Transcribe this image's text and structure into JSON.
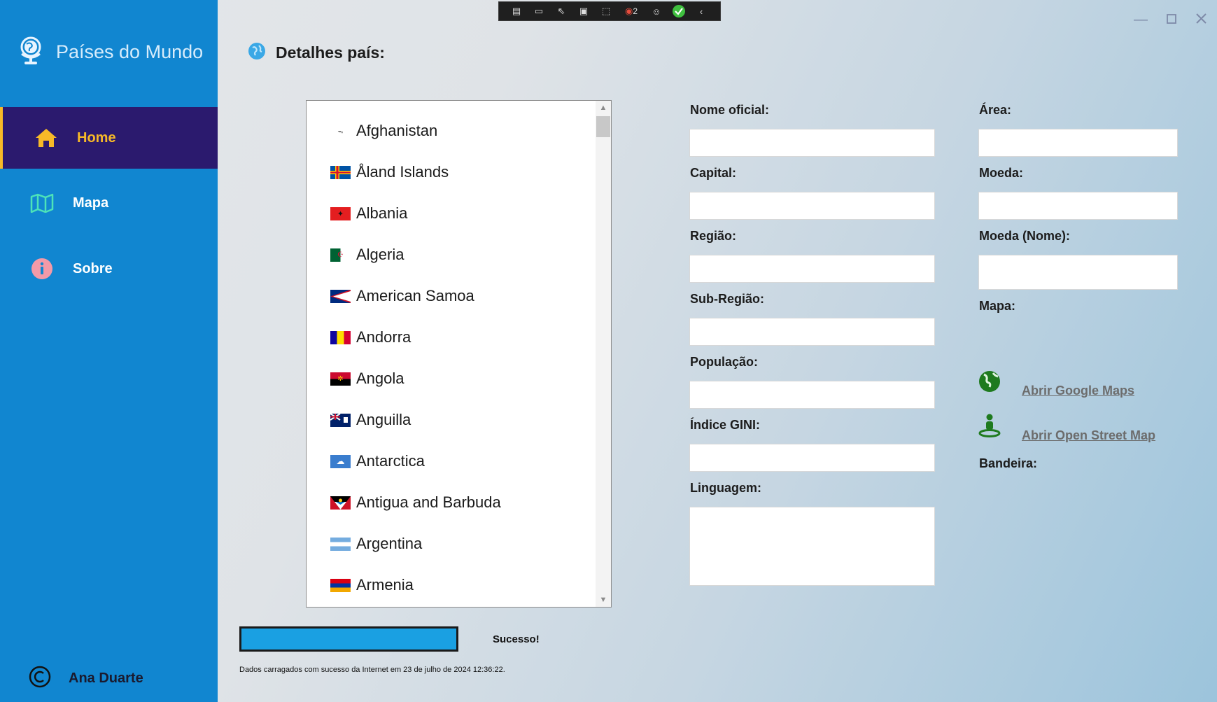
{
  "app": {
    "title": "Países do Mundo",
    "ghost_text": ""
  },
  "sidebar": {
    "items": [
      {
        "label": "Home",
        "icon": "home-icon",
        "active": true
      },
      {
        "label": "Mapa",
        "icon": "map-icon",
        "active": false
      },
      {
        "label": "Sobre",
        "icon": "info-icon",
        "active": false
      }
    ],
    "author": "Ana Duarte"
  },
  "toolbar": {
    "live_count": "2"
  },
  "main": {
    "title": "Detalhes país:",
    "countries": [
      {
        "name": "Afghanistan"
      },
      {
        "name": "Åland Islands"
      },
      {
        "name": "Albania"
      },
      {
        "name": "Algeria"
      },
      {
        "name": "American Samoa"
      },
      {
        "name": "Andorra"
      },
      {
        "name": "Angola"
      },
      {
        "name": "Anguilla"
      },
      {
        "name": "Antarctica"
      },
      {
        "name": "Antigua and Barbuda"
      },
      {
        "name": "Argentina"
      },
      {
        "name": "Armenia"
      }
    ],
    "fields": {
      "nome_oficial": {
        "label": "Nome oficial:",
        "value": ""
      },
      "capital": {
        "label": "Capital:",
        "value": ""
      },
      "regiao": {
        "label": "Região:",
        "value": ""
      },
      "sub_regiao": {
        "label": "Sub-Região:",
        "value": ""
      },
      "populacao": {
        "label": "População:",
        "value": ""
      },
      "gini": {
        "label": "Índice GINI:",
        "value": ""
      },
      "linguagem": {
        "label": "Linguagem:",
        "value": ""
      },
      "area": {
        "label": "Área:",
        "value": ""
      },
      "moeda": {
        "label": "Moeda:",
        "value": ""
      },
      "moeda_nome": {
        "label": "Moeda (Nome):",
        "value": ""
      },
      "mapa": {
        "label": "Mapa:"
      },
      "bandeira": {
        "label": "Bandeira:"
      }
    },
    "links": {
      "google_maps": "Abrir Google Maps",
      "osm": "Abrir Open Street Map"
    },
    "progress": {
      "percent": 100
    },
    "status": "Sucesso!",
    "status_message": "Dados carragados com sucesso da Internet em 23 de julho de 2024 12:36:22."
  },
  "colors": {
    "sidebar": "#1186d0",
    "active_nav": "#2b1a6e",
    "accent": "#f7b928",
    "progress": "#1aa0e2",
    "link_icon": "#1e7a1e"
  }
}
